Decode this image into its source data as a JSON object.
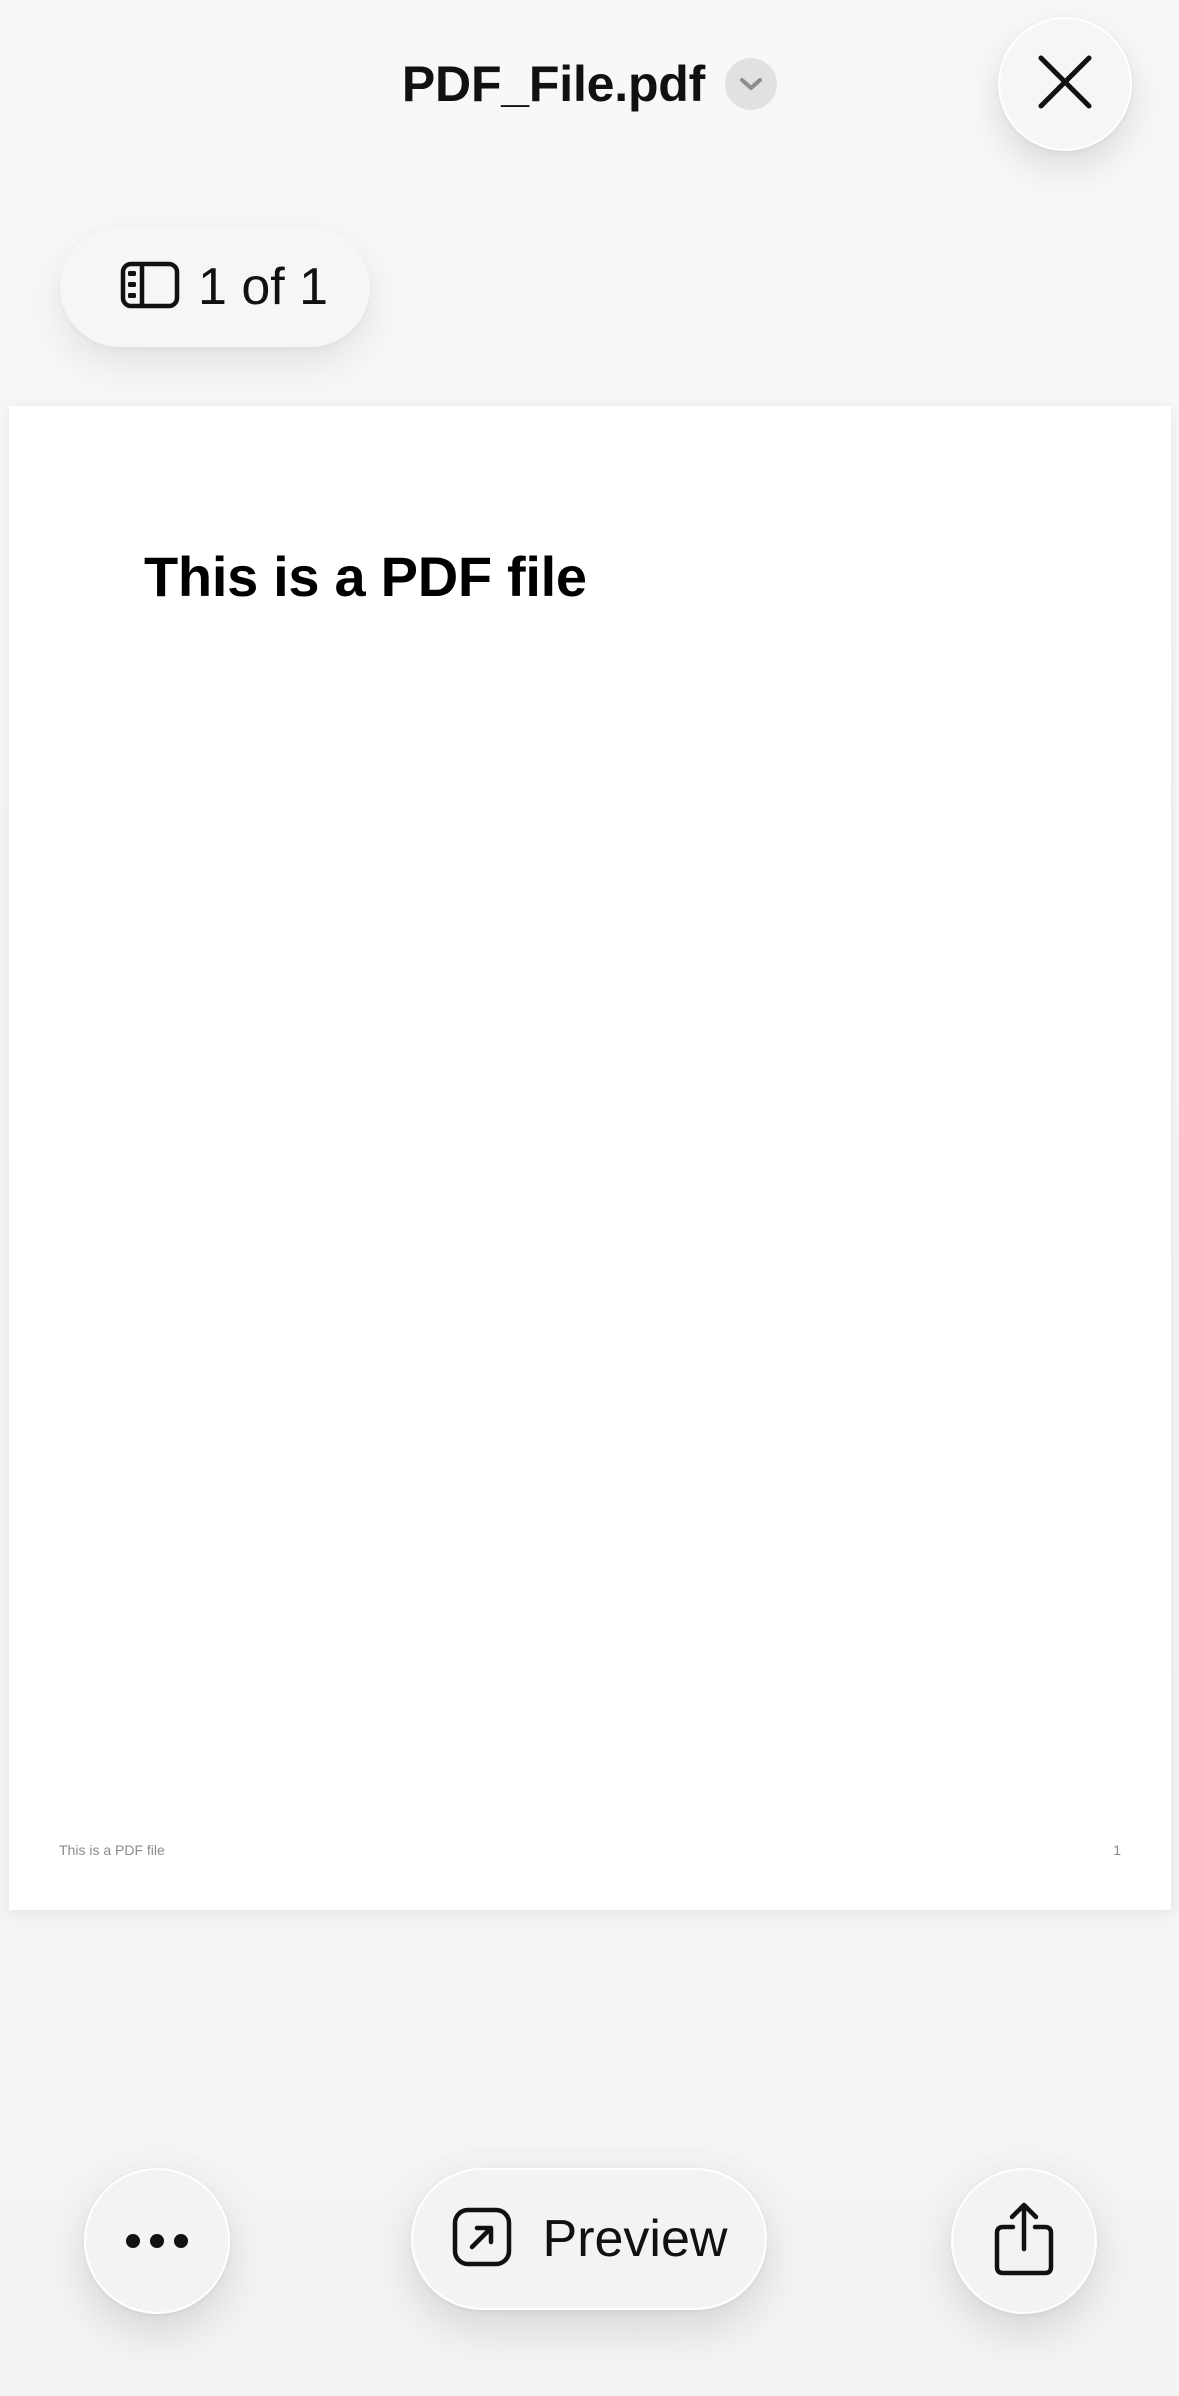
{
  "header": {
    "title": "PDF_File.pdf"
  },
  "page_indicator": {
    "text": "1 of 1"
  },
  "document": {
    "heading": "This is a PDF file",
    "footer_left": "This is a PDF file",
    "footer_page_number": "1"
  },
  "toolbar": {
    "preview_label": "Preview"
  },
  "icons": {
    "title_menu": "chevron-down-icon",
    "close": "close-icon",
    "sidebar": "sidebar-icon",
    "more": "ellipsis-icon",
    "preview": "arrow-up-right-square-icon",
    "share": "share-icon"
  },
  "colors": {
    "background": "#f7f7f7",
    "page": "#ffffff",
    "text": "#111111",
    "chevron_bg": "#e1e1e1",
    "muted_text": "#8a8a8a"
  }
}
